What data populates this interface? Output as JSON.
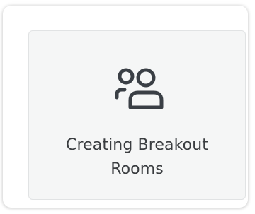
{
  "card": {
    "label_line1": "Creating Breakout",
    "label_line2": "Rooms",
    "icon": "users-icon"
  },
  "colors": {
    "tile_background": "#f5f6f6",
    "tile_border": "#e1e3e4",
    "text": "#3a3d40",
    "icon_stroke": "#3a3f45"
  }
}
